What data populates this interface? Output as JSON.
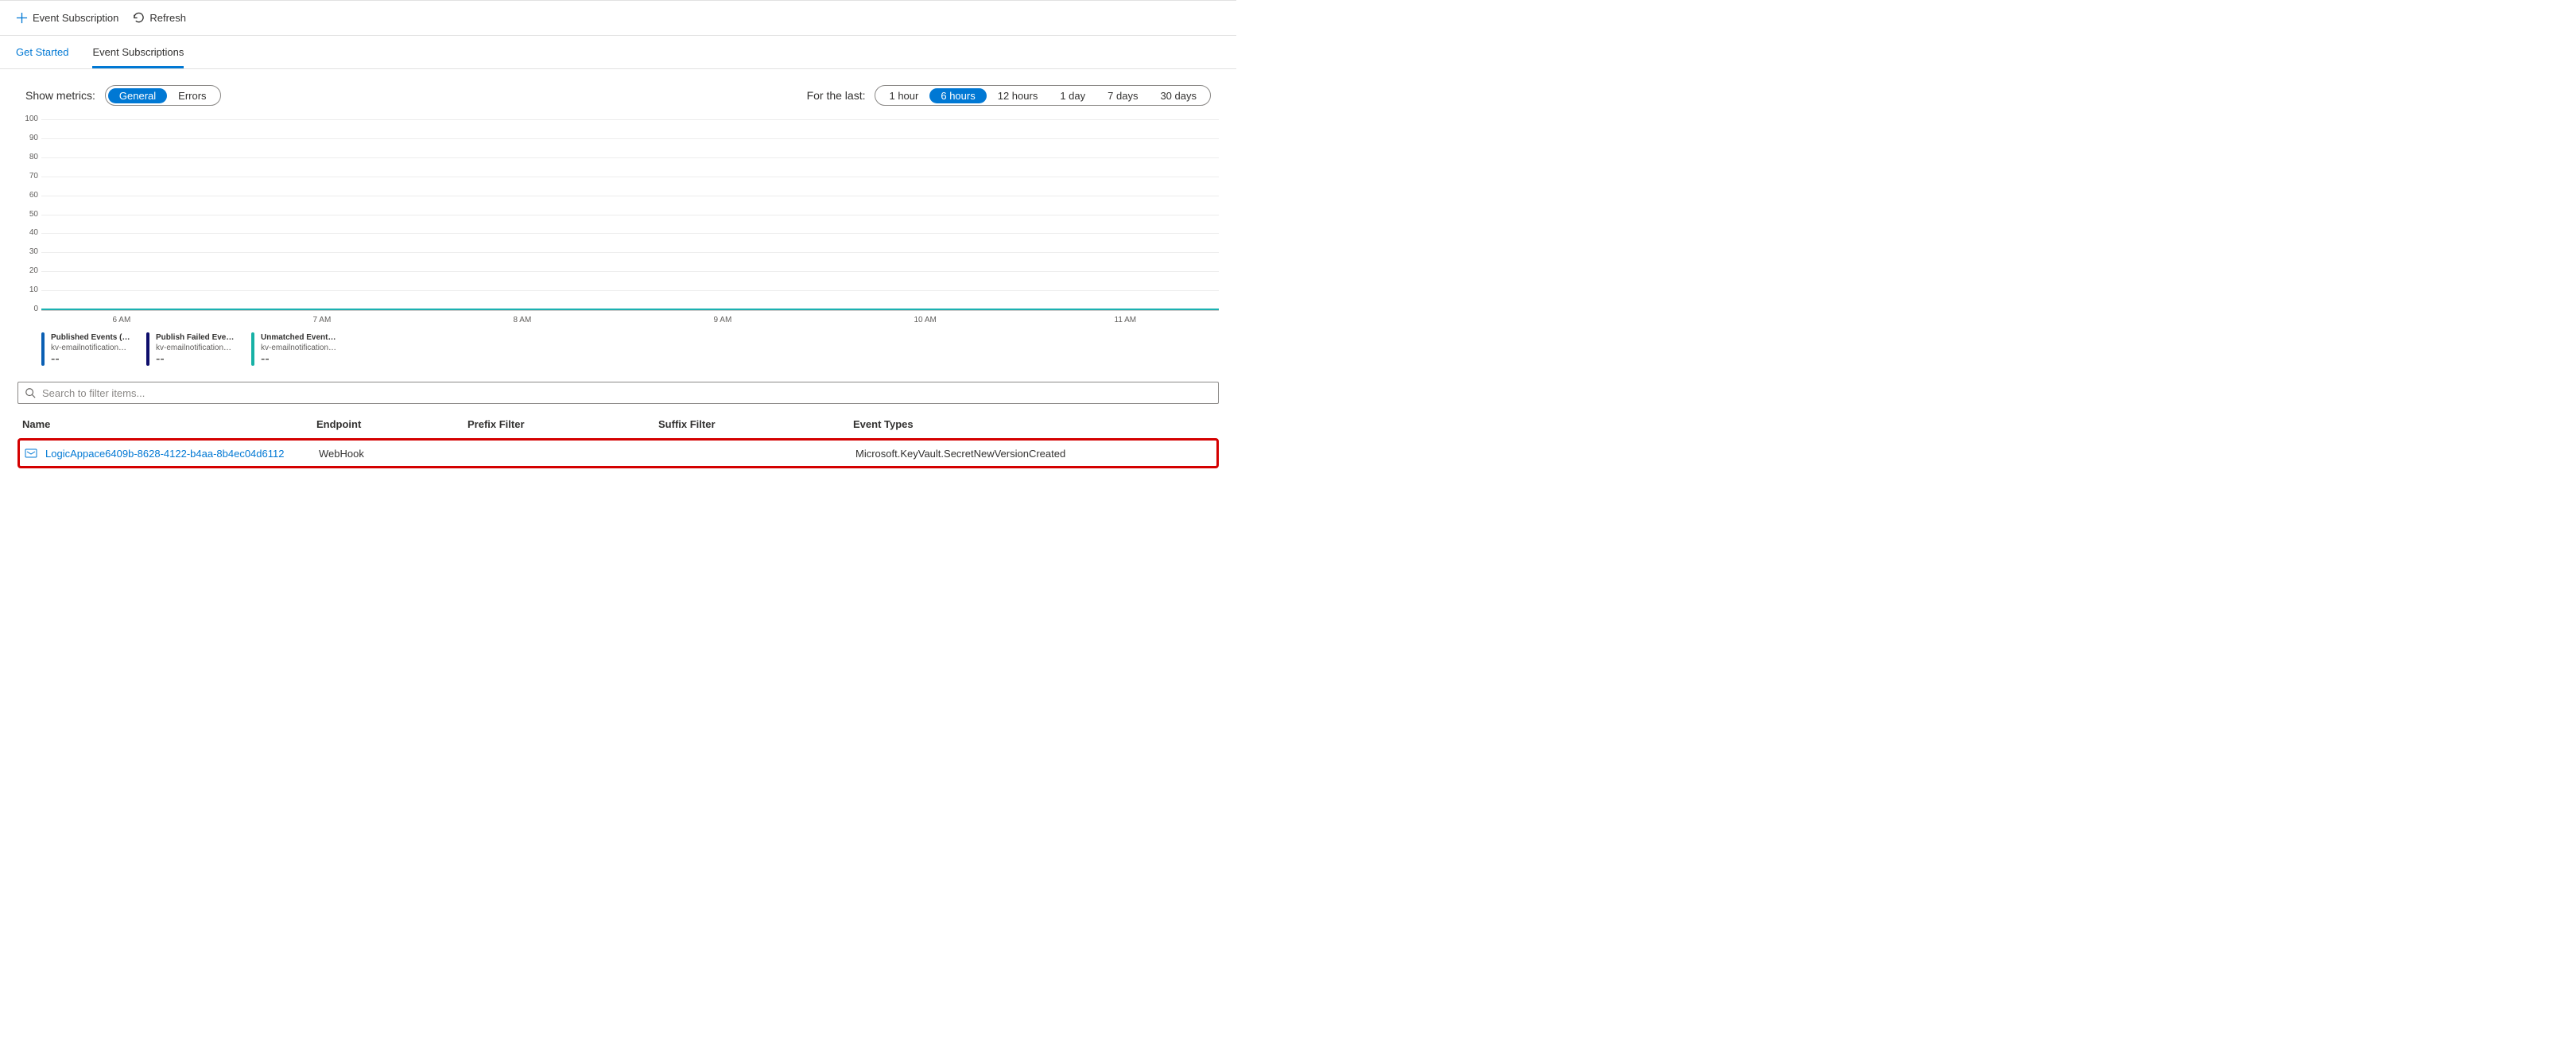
{
  "toolbar": {
    "add_label": "Event Subscription",
    "refresh_label": "Refresh"
  },
  "tabs": {
    "get_started": "Get Started",
    "event_subscriptions": "Event Subscriptions"
  },
  "metrics": {
    "label": "Show metrics:",
    "options": {
      "general": "General",
      "errors": "Errors"
    },
    "selected": "general"
  },
  "timerange": {
    "label": "For the last:",
    "options": {
      "h1": "1 hour",
      "h6": "6 hours",
      "h12": "12 hours",
      "d1": "1 day",
      "d7": "7 days",
      "d30": "30 days"
    },
    "selected": "h6"
  },
  "chart_data": {
    "type": "line",
    "title": "",
    "xlabel": "",
    "ylabel": "",
    "ylim": [
      0,
      100
    ],
    "yticks": [
      0,
      10,
      20,
      30,
      40,
      50,
      60,
      70,
      80,
      90,
      100
    ],
    "xticks": [
      "6 AM",
      "7 AM",
      "8 AM",
      "9 AM",
      "10 AM",
      "11 AM"
    ],
    "series": [
      {
        "name": "Published Events (Sum)",
        "sub": "kv-emailnotification…",
        "color": "#0a5fb3",
        "value_label": "--",
        "values": [
          0,
          0,
          0,
          0,
          0,
          0
        ]
      },
      {
        "name": "Publish Failed Event…",
        "sub": "kv-emailnotification…",
        "color": "#0d0d6b",
        "value_label": "--",
        "values": [
          0,
          0,
          0,
          0,
          0,
          0
        ]
      },
      {
        "name": "Unmatched Events (Sum)",
        "sub": "kv-emailnotification…",
        "color": "#17b1a5",
        "value_label": "--",
        "values": [
          0,
          0,
          0,
          0,
          0,
          0
        ]
      }
    ]
  },
  "search": {
    "placeholder": "Search to filter items..."
  },
  "table": {
    "headers": {
      "name": "Name",
      "endpoint": "Endpoint",
      "prefix": "Prefix Filter",
      "suffix": "Suffix Filter",
      "event_types": "Event Types"
    },
    "rows": [
      {
        "name": "LogicAppace6409b-8628-4122-b4aa-8b4ec04d6112",
        "endpoint": "WebHook",
        "prefix": "",
        "suffix": "",
        "event_types": "Microsoft.KeyVault.SecretNewVersionCreated"
      }
    ]
  }
}
